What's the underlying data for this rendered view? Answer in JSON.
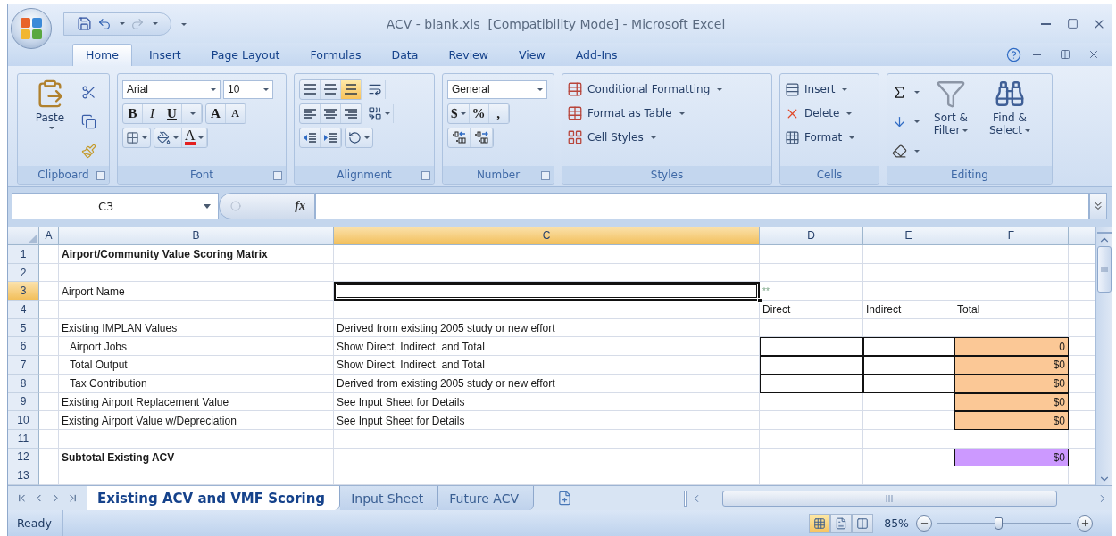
{
  "window": {
    "title": "ACV - blank.xls  [Compatibility Mode] - Microsoft Excel"
  },
  "tabs": [
    {
      "label": "Home",
      "selected": true
    },
    {
      "label": "Insert",
      "selected": false
    },
    {
      "label": "Page Layout",
      "selected": false
    },
    {
      "label": "Formulas",
      "selected": false
    },
    {
      "label": "Data",
      "selected": false
    },
    {
      "label": "Review",
      "selected": false
    },
    {
      "label": "View",
      "selected": false
    },
    {
      "label": "Add-Ins",
      "selected": false
    }
  ],
  "ribbon": {
    "clipboard": {
      "label": "Clipboard",
      "paste": "Paste"
    },
    "font": {
      "label": "Font",
      "name": "Arial",
      "size": "10",
      "bold": "B",
      "italic": "I",
      "underline": "U",
      "grow": "A",
      "shrink": "A",
      "text_color": "A"
    },
    "alignment": {
      "label": "Alignment",
      "vertical": [
        {
          "selected": false
        },
        {
          "selected": false
        },
        {
          "selected": true
        }
      ]
    },
    "number": {
      "label": "Number",
      "format": "General",
      "currency": "$",
      "percent": "%",
      "comma": ","
    },
    "styles": {
      "label": "Styles",
      "buttons": [
        "Conditional Formatting",
        "Format as Table",
        "Cell Styles"
      ]
    },
    "cells": {
      "label": "Cells",
      "buttons": [
        "Insert",
        "Delete",
        "Format"
      ]
    },
    "editing": {
      "label": "Editing",
      "buttons": [
        "Sort & Filter",
        "Find & Select"
      ]
    }
  },
  "formula_bar": {
    "name_box": "C3",
    "function_label": "fx"
  },
  "sheet": {
    "columns": [
      {
        "label": "A",
        "selected": false
      },
      {
        "label": "B",
        "selected": false
      },
      {
        "label": "C",
        "selected": true
      },
      {
        "label": "D",
        "selected": false
      },
      {
        "label": "E",
        "selected": false
      },
      {
        "label": "F",
        "selected": false
      }
    ],
    "rows": [
      {
        "header": "1",
        "selected": false,
        "b": {
          "text": "Airport/Community Value Scoring Matrix",
          "bold": true
        }
      },
      {
        "header": "2",
        "selected": false
      },
      {
        "header": "3",
        "selected": true,
        "b": {
          "text": "Airport Name"
        },
        "c": {
          "active": true
        },
        "d": {
          "text": "**",
          "small": true
        }
      },
      {
        "header": "4",
        "selected": false,
        "d": {
          "text": "Direct"
        },
        "e": {
          "text": "Indirect"
        },
        "f": {
          "text": "Total"
        }
      },
      {
        "header": "5",
        "selected": false,
        "b": {
          "text": "Existing IMPLAN Values"
        },
        "c": {
          "text": "Derived from existing 2005 study or new effort"
        }
      },
      {
        "header": "6",
        "selected": false,
        "b": {
          "text": "Airport Jobs",
          "indented": true
        },
        "c": {
          "text": "Show Direct, Indirect, and Total"
        },
        "d": {
          "bordered": true
        },
        "e": {
          "bordered": true
        },
        "f": {
          "text": "0",
          "right_aligned": true,
          "color": "#fbc896",
          "bordered": true
        }
      },
      {
        "header": "7",
        "selected": false,
        "b": {
          "text": "Total Output",
          "indented": true
        },
        "c": {
          "text": "Show Direct, Indirect, and Total"
        },
        "d": {
          "bordered": true
        },
        "e": {
          "bordered": true
        },
        "f": {
          "text": "$0",
          "right_aligned": true,
          "color": "#fbc896",
          "bordered": true
        }
      },
      {
        "header": "8",
        "selected": false,
        "b": {
          "text": "Tax Contribution",
          "indented": true
        },
        "c": {
          "text": "Derived from existing 2005 study or new effort"
        },
        "d": {
          "bordered": true
        },
        "e": {
          "bordered": true
        },
        "f": {
          "text": "$0",
          "right_aligned": true,
          "color": "#fbc896",
          "bordered": true
        }
      },
      {
        "header": "9",
        "selected": false,
        "b": {
          "text": "Existing Airport Replacement Value"
        },
        "c": {
          "text": "See Input Sheet for Details"
        },
        "f": {
          "text": "$0",
          "right_aligned": true,
          "color": "#fbc896",
          "bordered": true
        }
      },
      {
        "header": "10",
        "selected": false,
        "b": {
          "text": "Existing Airport Value w/Depreciation"
        },
        "c": {
          "text": "See Input Sheet for Details"
        },
        "f": {
          "text": "$0",
          "right_aligned": true,
          "color": "#fbc896",
          "bordered": true
        }
      },
      {
        "header": "11",
        "selected": false
      },
      {
        "header": "12",
        "selected": false,
        "b": {
          "text": "Subtotal Existing ACV",
          "bold": true
        },
        "f": {
          "text": "$0",
          "right_aligned": true,
          "color": "#cc99ff",
          "bordered": true
        }
      },
      {
        "header": "13",
        "selected": false
      }
    ]
  },
  "sheet_tabs": [
    {
      "label": "Existing ACV and VMF Scoring",
      "selected": true
    },
    {
      "label": "Input Sheet",
      "selected": false
    },
    {
      "label": "Future ACV",
      "selected": false
    }
  ],
  "status_bar": {
    "status": "Ready",
    "views": [
      {
        "selected": true
      },
      {
        "selected": false
      },
      {
        "selected": false
      }
    ],
    "zoom": "85%",
    "zoom_slider": {
      "level": 0.45
    }
  }
}
